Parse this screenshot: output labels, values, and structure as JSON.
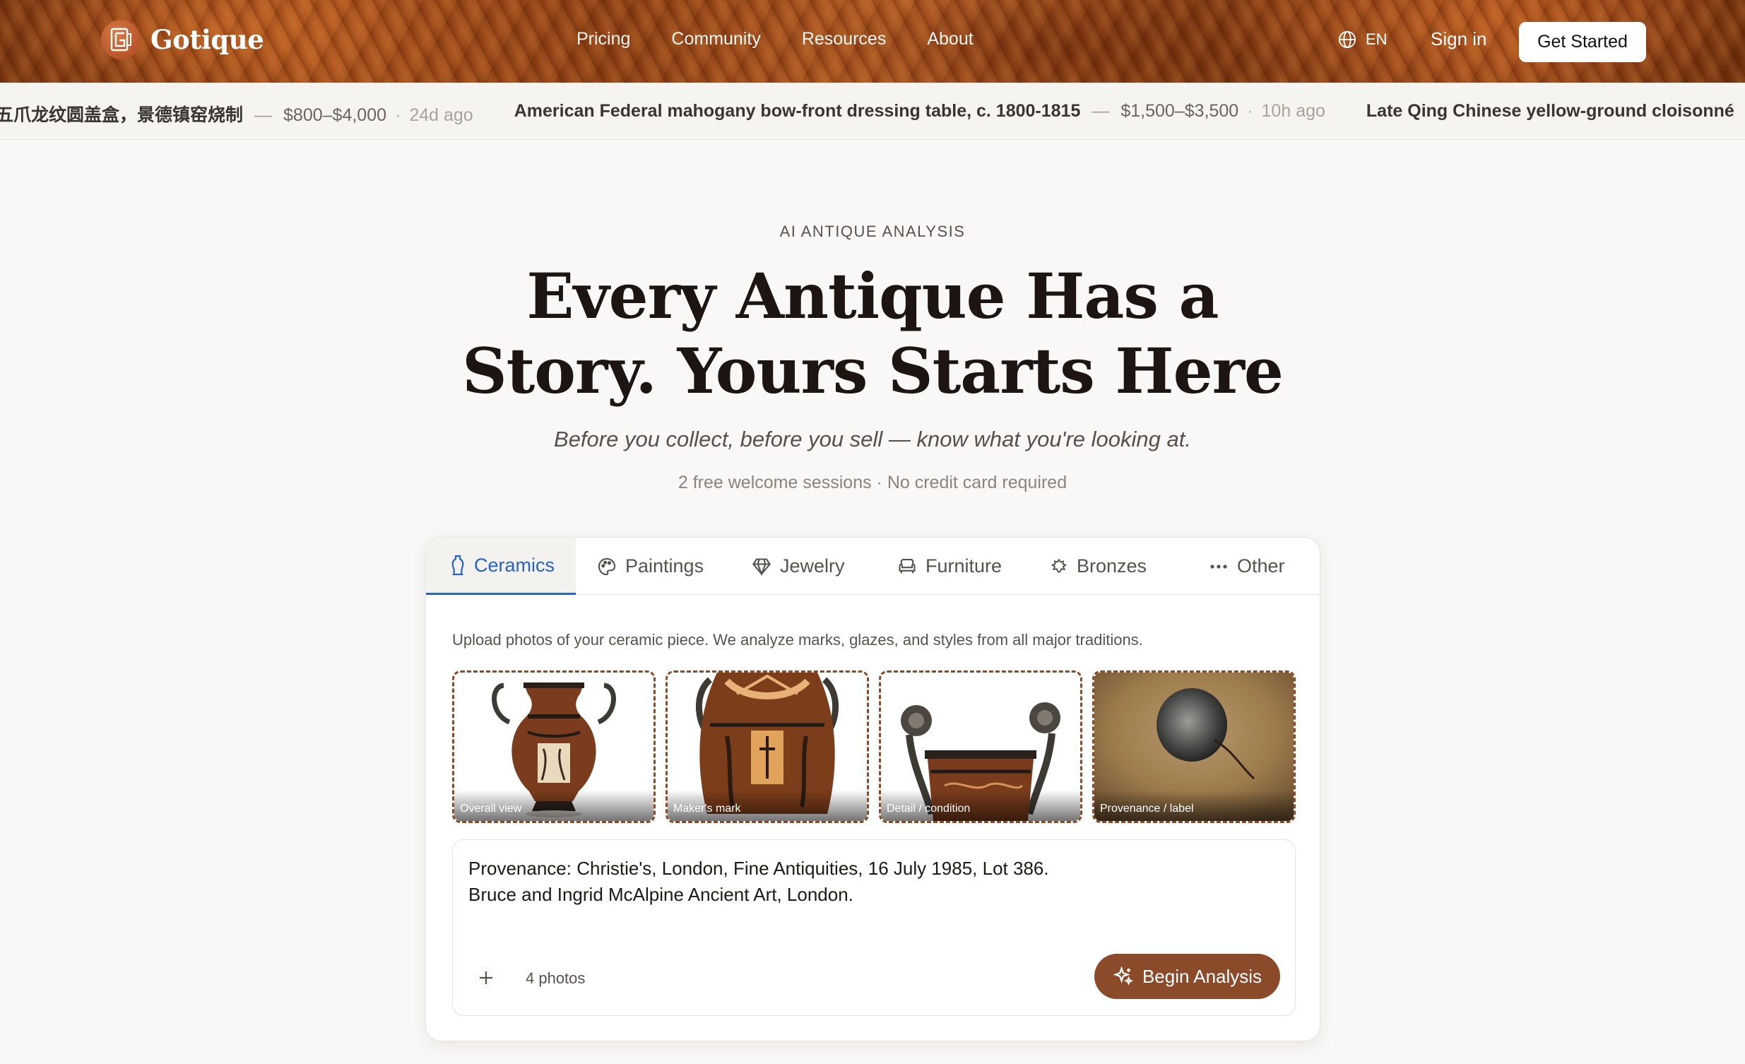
{
  "header": {
    "brand": "Gotique",
    "nav": [
      "Pricing",
      "Community",
      "Resources",
      "About"
    ],
    "lang": "EN",
    "sign_in": "Sign in",
    "get_started": "Get Started"
  },
  "ticker": [
    {
      "title": "五爪龙纹圆盖盒，景德镇窑烧制",
      "price": "$800–$4,000",
      "age": "24d ago"
    },
    {
      "title": "American Federal mahogany bow-front dressing table, c. 1800-1815",
      "price": "$1,500–$3,500",
      "age": "10h ago"
    },
    {
      "title": "Late Qing Chinese yellow-ground cloisonné",
      "price": "",
      "age": ""
    }
  ],
  "hero": {
    "eyebrow": "AI ANTIQUE ANALYSIS",
    "headline_line1": "Every Antique Has a",
    "headline_line2": "Story. Yours Starts Here",
    "subhead": "Before you collect, before you sell — know what you're looking at.",
    "note": "2 free welcome sessions · No credit card required"
  },
  "tabs": [
    {
      "label": "Ceramics",
      "icon": "vase-icon",
      "active": true
    },
    {
      "label": "Paintings",
      "icon": "palette-icon",
      "active": false
    },
    {
      "label": "Jewelry",
      "icon": "gem-icon",
      "active": false
    },
    {
      "label": "Furniture",
      "icon": "armchair-icon",
      "active": false
    },
    {
      "label": "Bronzes",
      "icon": "bronze-icon",
      "active": false
    },
    {
      "label": "Other",
      "icon": "more-icon",
      "active": false
    }
  ],
  "upload": {
    "description": "Upload photos of your ceramic piece. We analyze marks, glazes, and styles from all major traditions.",
    "photos": [
      "Overall view",
      "Maker's mark",
      "Detail / condition",
      "Provenance / label"
    ],
    "notes_line1": "Provenance: Christie's, London, Fine Antiquities, 16 July 1985, Lot 386.",
    "notes_line2": "Bruce and Ingrid McAlpine Ancient Art, London.",
    "photo_count": "4 photos",
    "begin": "Begin Analysis"
  },
  "colors": {
    "accent_blue": "#2563c9",
    "button_brown": "#8b4a2a",
    "photo_border": "#8a4a26"
  }
}
